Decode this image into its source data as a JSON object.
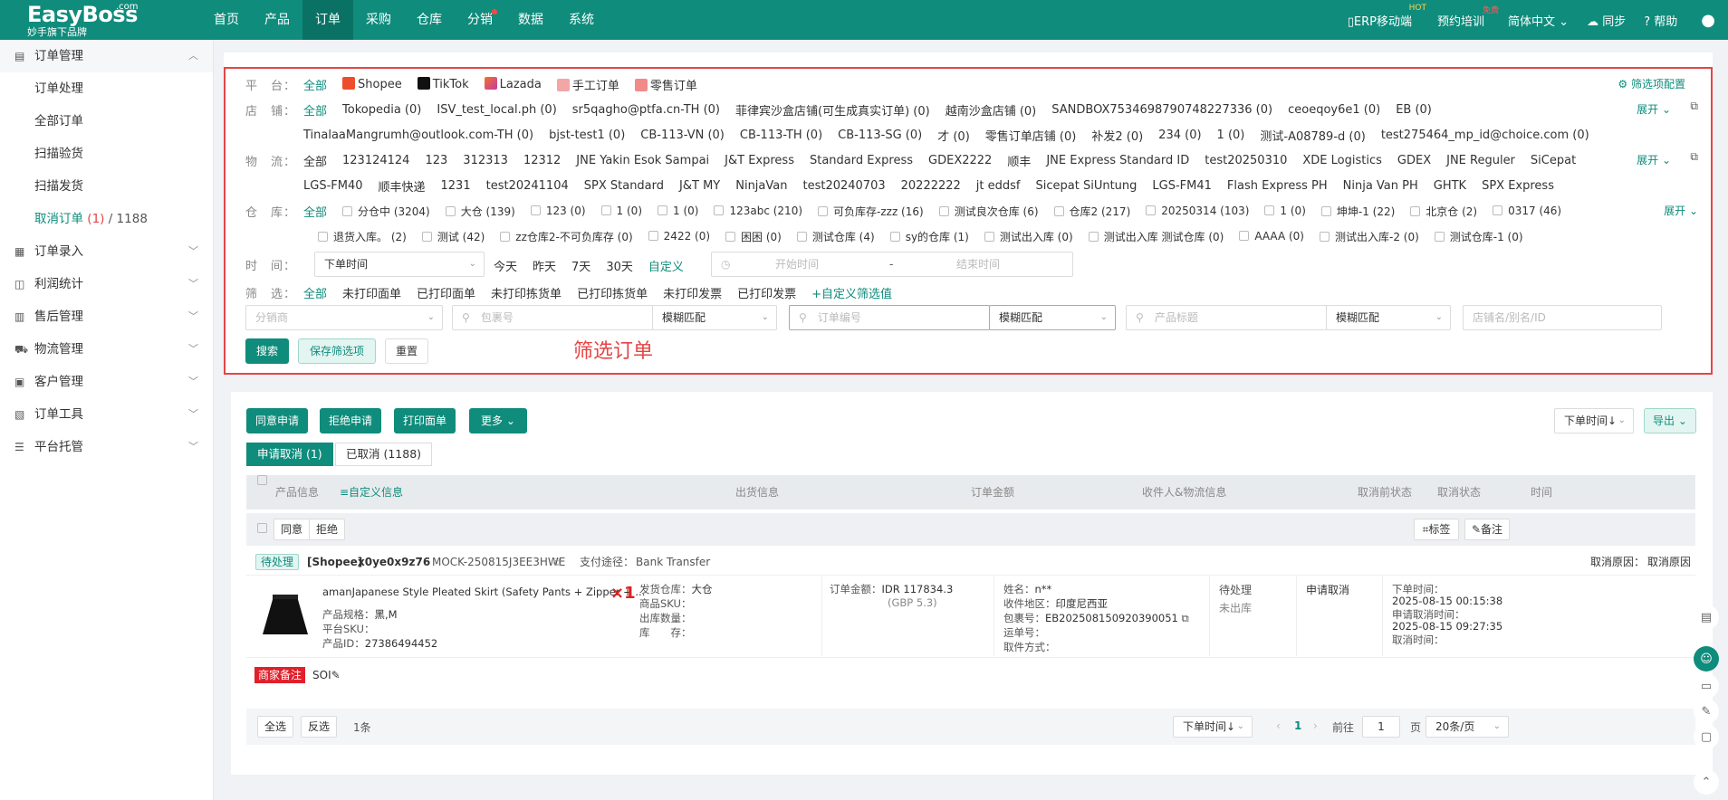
{
  "topbar": {
    "logo": "EasyBoss",
    "logo_com": ".com",
    "logo_sub": "妙手旗下品牌",
    "nav": [
      "首页",
      "产品",
      "订单",
      "采购",
      "仓库",
      "分销",
      "数据",
      "系统"
    ],
    "right": {
      "mobile": "ERP移动端",
      "mobile_badge": "HOT",
      "train": "预约培训",
      "train_badge": "免费",
      "lang": "简体中文",
      "sync": "同步",
      "help": "帮助"
    }
  },
  "sidebar": {
    "groups": [
      {
        "label": "订单管理",
        "icon": "order-icon"
      },
      {
        "label": "订单录入",
        "icon": "entry-icon"
      },
      {
        "label": "利润统计",
        "icon": "profit-icon"
      },
      {
        "label": "售后管理",
        "icon": "aftersale-icon"
      },
      {
        "label": "物流管理",
        "icon": "truck-icon"
      },
      {
        "label": "客户管理",
        "icon": "customer-icon"
      },
      {
        "label": "订单工具",
        "icon": "tool-icon"
      },
      {
        "label": "平台托管",
        "icon": "platform-icon"
      }
    ],
    "sub": [
      "订单处理",
      "全部订单",
      "扫描验货",
      "扫描发货"
    ],
    "cancel_label": "取消订单",
    "cancel_count": "(1)",
    "cancel_total": "/ 1188"
  },
  "filter": {
    "platform": {
      "label": "平　台：",
      "items": [
        "全部",
        "Shopee",
        "TikTok",
        "Lazada",
        "手工订单",
        "零售订单"
      ],
      "config": "筛选项配置"
    },
    "store": {
      "label": "店　铺：",
      "row1": [
        "全部",
        "Tokopedia (0)",
        "ISV_test_local.ph (0)",
        "sr5qagho@ptfa.cn-TH (0)",
        "菲律宾沙盒店铺(可生成真实订单) (0)",
        "越南沙盒店铺 (0)",
        "SANDBOX7534698790748227336 (0)",
        "ceoeqoy6e1 (0)",
        "EB (0)"
      ],
      "row2": [
        "TinalaaMangrumh@outlook.com-TH (0)",
        "bjst-test1 (0)",
        "CB-113-VN (0)",
        "CB-113-TH (0)",
        "CB-113-SG (0)",
        "才 (0)",
        "零售订单店铺 (0)",
        "补发2 (0)",
        "234 (0)",
        "1 (0)",
        "测试-A08789-d (0)",
        "test275464_mp_id@choice.com (0)"
      ]
    },
    "logistics": {
      "label": "物　流：",
      "row1": [
        "全部",
        "123124124",
        "123",
        "312313",
        "12312",
        "JNE Yakin Esok Sampai",
        "J&T Express",
        "Standard Express",
        "GDEX2222",
        "顺丰",
        "JNE Express Standard ID",
        "test20250310",
        "XDE Logistics",
        "GDEX",
        "JNE Reguler",
        "SiCepat"
      ],
      "row2": [
        "LGS-FM40",
        "顺丰快递",
        "1231",
        "test20241104",
        "SPX Standard",
        "J&T MY",
        "NinjaVan",
        "test20240703",
        "20222222",
        "jt eddsf",
        "Sicepat SiUntung",
        "LGS-FM41",
        "Flash Express PH",
        "Ninja Van PH",
        "GHTK",
        "SPX Express"
      ]
    },
    "warehouse": {
      "label": "仓　库：",
      "all": "全部",
      "row1": [
        "分仓中 (3204)",
        "大仓 (139)",
        "123 (0)",
        "1 (0)",
        "1 (0)",
        "123abc (210)",
        "可负库存-zzz (16)",
        "测试良次仓库 (6)",
        "仓库2 (217)",
        "20250314 (103)",
        "1 (0)",
        "坤坤-1 (22)",
        "北京仓 (2)",
        "0317 (46)"
      ],
      "row2": [
        "退货入库。 (2)",
        "测试 (42)",
        "zz仓库2-不可负库存 (0)",
        "2422 (0)",
        "困困 (0)",
        "测试仓库 (4)",
        "sy的仓库 (1)",
        "测试出入库 (0)",
        "测试出入库 测试仓库 (0)",
        "AAAA (0)",
        "测试出入库-2 (0)",
        "测试仓库-1 (0)"
      ]
    },
    "expand": "展开",
    "time": {
      "label": "时　间：",
      "type": "下单时间",
      "quick": [
        "今天",
        "昨天",
        "7天",
        "30天",
        "自定义"
      ],
      "start": "开始时间",
      "sep": "-",
      "end": "结束时间"
    },
    "screen": {
      "label": "筛　选：",
      "items": [
        "全部",
        "未打印面单",
        "已打印面单",
        "未打印拣货单",
        "已打印拣货单",
        "未打印发票",
        "已打印发票"
      ],
      "custom": "+自定义筛选值"
    },
    "inputs": {
      "distributor": "分销商",
      "package": "包裹号",
      "order": "订单编号",
      "title": "产品标题",
      "store": "店铺名/别名/ID",
      "match": "模糊匹配"
    },
    "buttons": {
      "search": "搜索",
      "save": "保存筛选项",
      "reset": "重置"
    },
    "annotation": "筛选订单"
  },
  "main": {
    "actions": [
      "同意申请",
      "拒绝申请",
      "打印面单",
      "更多"
    ],
    "sort": "下单时间↓",
    "export": "导出",
    "tabs": [
      "申请取消 (1)",
      "已取消 (1188)"
    ],
    "headers": [
      "产品信息",
      "≡自定义信息",
      "出货信息",
      "订单金额",
      "收件人&物流信息",
      "取消前状态",
      "取消状态",
      "时间"
    ],
    "bulk": {
      "agree": "同意",
      "reject": "拒绝",
      "tag": "标签",
      "note": "备注"
    },
    "order": {
      "status": "待处理",
      "platform": "[Shopee]",
      "id": "x0ye0x9z76",
      "mock": "MOCK-250815J3EE3HWE",
      "pay_label": "支付途径：",
      "pay": "Bank Transfer",
      "reason_label": "取消原因：",
      "reason": "取消原因",
      "product": "amanJapanese Style Pleated Skirt (Safety Pants + Zipper + ...",
      "spec_label": "产品规格：",
      "spec": "黑,M",
      "psku_label": "平台SKU：",
      "pid_label": "产品ID：",
      "pid": "27386494452",
      "qty": "×1",
      "ship_wh_label": "发货仓库：",
      "ship_wh": "大仓",
      "sku_label": "商品SKU：",
      "out_label": "出库数量：",
      "stock_label": "库　　存：",
      "amt_label": "订单金额：",
      "amount": "IDR 117834.3",
      "amount_gbp": "(GBP 5.3)",
      "name_label": "姓名：",
      "name": "n**",
      "region_label": "收件地区：",
      "region": "印度尼西亚",
      "pkg_label": "包裹号：",
      "pkg": "EB202508150920390051",
      "track_label": "运单号：",
      "pickup_label": "取件方式：",
      "pre_status": "待处理",
      "pre_status2": "未出库",
      "cancel_status": "申请取消",
      "time1_label": "下单时间：",
      "time1": "2025-08-15 00:15:38",
      "time2_label": "申请取消时间：",
      "time2": "2025-08-15 09:27:35",
      "time3_label": "取消时间：",
      "note_tag": "商家备注",
      "note": "SOI"
    },
    "footer": {
      "all": "全选",
      "invert": "反选",
      "count": "1条",
      "sort": "下单时间↓",
      "page": "1",
      "goto": "前往",
      "goto_val": "1",
      "page_unit": "页",
      "per": "20条/页"
    }
  },
  "colors": {
    "brand": "#0f8c7c",
    "highlight": "#e54545",
    "note_tag": "#e0202a"
  }
}
